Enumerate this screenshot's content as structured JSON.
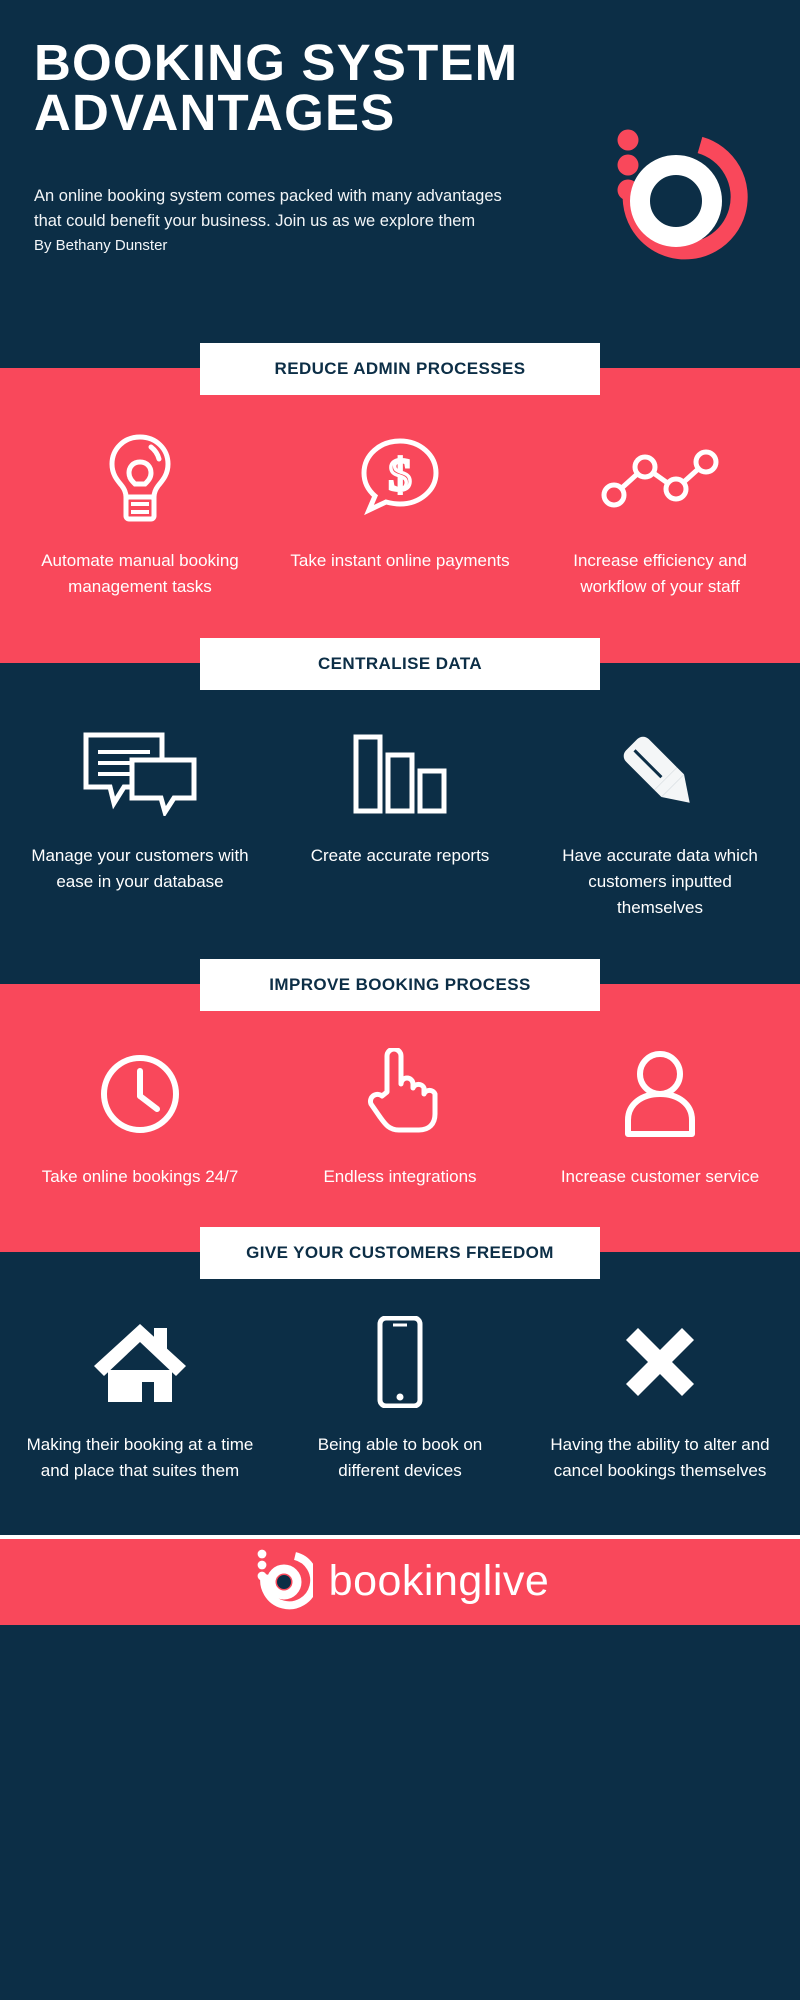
{
  "colors": {
    "navy": "#0c2e46",
    "red": "#f9485b",
    "white": "#ffffff"
  },
  "header": {
    "title_line1": "BOOKING SYSTEM",
    "title_line2": "ADVANTAGES",
    "intro": "An online booking system comes packed with many advantages that could benefit your business. Join us as we explore them",
    "byline": "By Bethany Dunster",
    "logo_name": "bookinglive-logo-mark"
  },
  "sections": [
    {
      "banner": "REDUCE ADMIN PROCESSES",
      "theme": "red",
      "cards": [
        {
          "icon": "lightbulb-icon",
          "label": "Automate manual booking management tasks"
        },
        {
          "icon": "dollar-speech-bubble-icon",
          "label": "Take instant online payments"
        },
        {
          "icon": "line-chart-icon",
          "label": "Increase efficiency and workflow of your staff"
        }
      ]
    },
    {
      "banner": "CENTRALISE DATA",
      "theme": "navy",
      "cards": [
        {
          "icon": "chat-bubbles-icon",
          "label": "Manage your customers with ease in your database"
        },
        {
          "icon": "bar-chart-icon",
          "label": "Create accurate reports"
        },
        {
          "icon": "pen-icon",
          "label": "Have accurate data which customers inputted themselves"
        }
      ]
    },
    {
      "banner": "IMPROVE BOOKING PROCESS",
      "theme": "red",
      "cards": [
        {
          "icon": "clock-icon",
          "label": "Take online bookings 24/7"
        },
        {
          "icon": "pointing-hand-icon",
          "label": "Endless integrations"
        },
        {
          "icon": "person-icon",
          "label": "Increase customer service"
        }
      ]
    },
    {
      "banner": "GIVE YOUR CUSTOMERS FREEDOM",
      "theme": "navy",
      "cards": [
        {
          "icon": "house-icon",
          "label": "Making their booking at a time and place that suites them"
        },
        {
          "icon": "smartphone-icon",
          "label": "Being able to book on different devices"
        },
        {
          "icon": "cross-icon",
          "label": "Having the ability to alter and cancel bookings themselves"
        }
      ]
    }
  ],
  "footer": {
    "wordmark": "bookinglive",
    "logo_name": "bookinglive-logo-mark"
  }
}
